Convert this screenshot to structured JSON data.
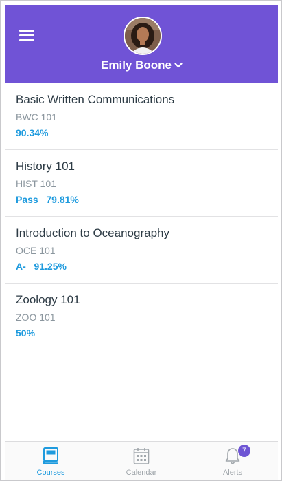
{
  "header": {
    "user_name": "Emily Boone",
    "colors": {
      "background": "#7053d6",
      "text": "#ffffff"
    }
  },
  "courses": [
    {
      "title": "Basic Written Communications",
      "code": "BWC 101",
      "grade": "90.34%"
    },
    {
      "title": "History 101",
      "code": "HIST 101",
      "grade": "Pass   79.81%"
    },
    {
      "title": "Introduction to Oceanography",
      "code": "OCE 101",
      "grade": "A-   91.25%"
    },
    {
      "title": "Zoology 101",
      "code": "ZOO 101",
      "grade": "50%"
    }
  ],
  "tabbar": {
    "tabs": [
      {
        "label": "Courses",
        "icon": "book-icon",
        "active": true
      },
      {
        "label": "Calendar",
        "icon": "calendar-icon",
        "active": false
      },
      {
        "label": "Alerts",
        "icon": "bell-icon",
        "active": false,
        "badge": "7"
      }
    ],
    "colors": {
      "active": "#1f9bde",
      "inactive": "#a0a6ab",
      "badge": "#6e55d4"
    }
  }
}
